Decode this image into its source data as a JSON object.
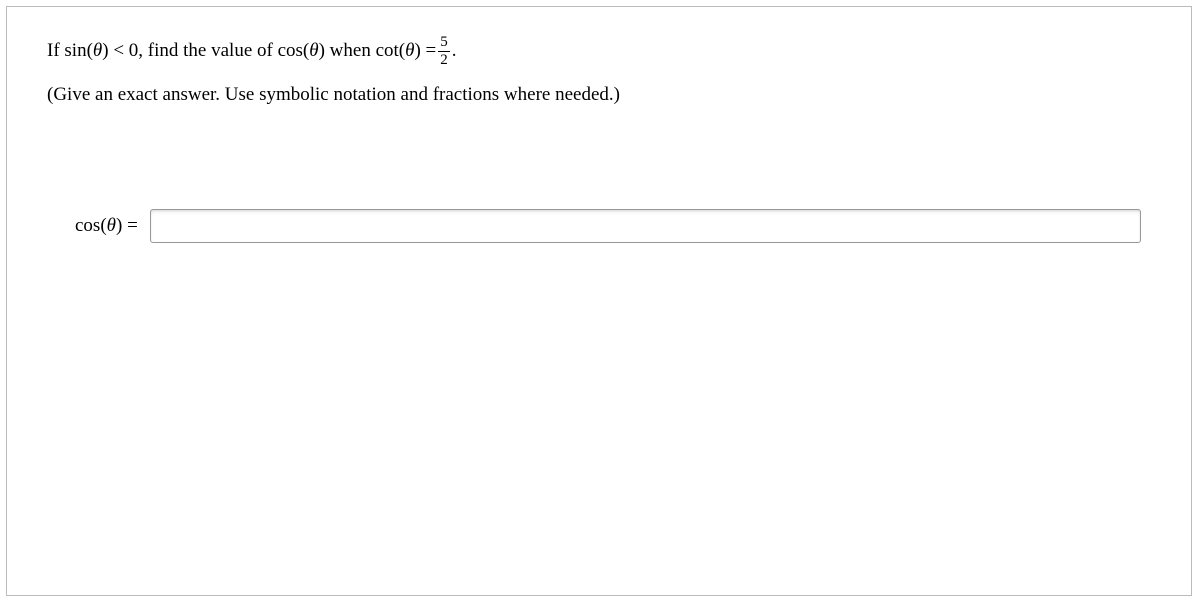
{
  "question": {
    "line1_part1": "If sin(",
    "theta": "θ",
    "line1_part2": ") < 0, find the value of cos(",
    "line1_part3": ") when cot(",
    "line1_part4": ") = ",
    "fraction_num": "5",
    "fraction_den": "2",
    "line1_part5": ".",
    "line2": "(Give an exact answer. Use symbolic notation and fractions where needed.)"
  },
  "answer": {
    "label_part1": "cos(",
    "label_part2": ") =",
    "input_value": ""
  }
}
